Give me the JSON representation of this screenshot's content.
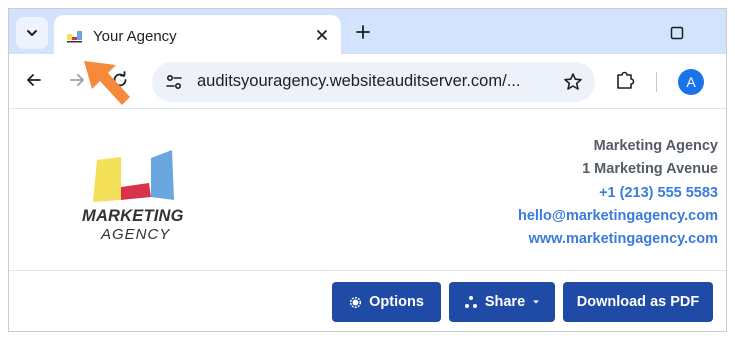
{
  "browser": {
    "tab": {
      "title": "Your Agency"
    },
    "omnibox": {
      "url": "auditsyouragency.websiteauditserver.com/..."
    },
    "profile": {
      "initial": "A"
    },
    "accent_color": "#d3e3fd"
  },
  "agency": {
    "logo": {
      "line1": "MARKETING",
      "line2": "AGENCY",
      "colors": [
        "#f5e05a",
        "#d8334a",
        "#6aa6e0"
      ]
    },
    "contact": {
      "name": "Marketing Agency",
      "address": "1 Marketing Avenue",
      "phone": "+1 (213) 555 5583",
      "email": "hello@marketingagency.com",
      "website": "www.marketingagency.com"
    }
  },
  "actions": {
    "options_label": "Options",
    "share_label": "Share",
    "download_label": "Download as PDF",
    "button_color": "#1f4aa5"
  },
  "icons": [
    "chevron-down-icon",
    "close-icon",
    "plus-icon",
    "maximize-icon",
    "back-arrow-icon",
    "forward-arrow-icon",
    "reload-icon",
    "site-info-icon",
    "star-icon",
    "extensions-icon",
    "gear-icon",
    "share-icon",
    "caret-down-icon",
    "cursor-arrow-icon"
  ]
}
